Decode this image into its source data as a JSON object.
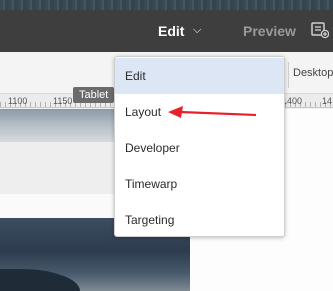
{
  "toolbar": {
    "mode_label": "Edit",
    "preview_label": "Preview",
    "annotation_icon": "annotation-icon"
  },
  "devicebar": {
    "desktop_label": "Desktop"
  },
  "ruler": {
    "labels": [
      "1100",
      "1150",
      "1400",
      "14"
    ],
    "tablet_tag": "Tablet"
  },
  "mode_menu": {
    "items": [
      {
        "label": "Edit",
        "selected": true
      },
      {
        "label": "Layout",
        "selected": false
      },
      {
        "label": "Developer",
        "selected": false
      },
      {
        "label": "Timewarp",
        "selected": false
      },
      {
        "label": "Targeting",
        "selected": false
      }
    ]
  },
  "colors": {
    "toolbar": "#3e3e3e",
    "menu_selected": "#dce6f4",
    "annotation_arrow": "#e8202a"
  }
}
